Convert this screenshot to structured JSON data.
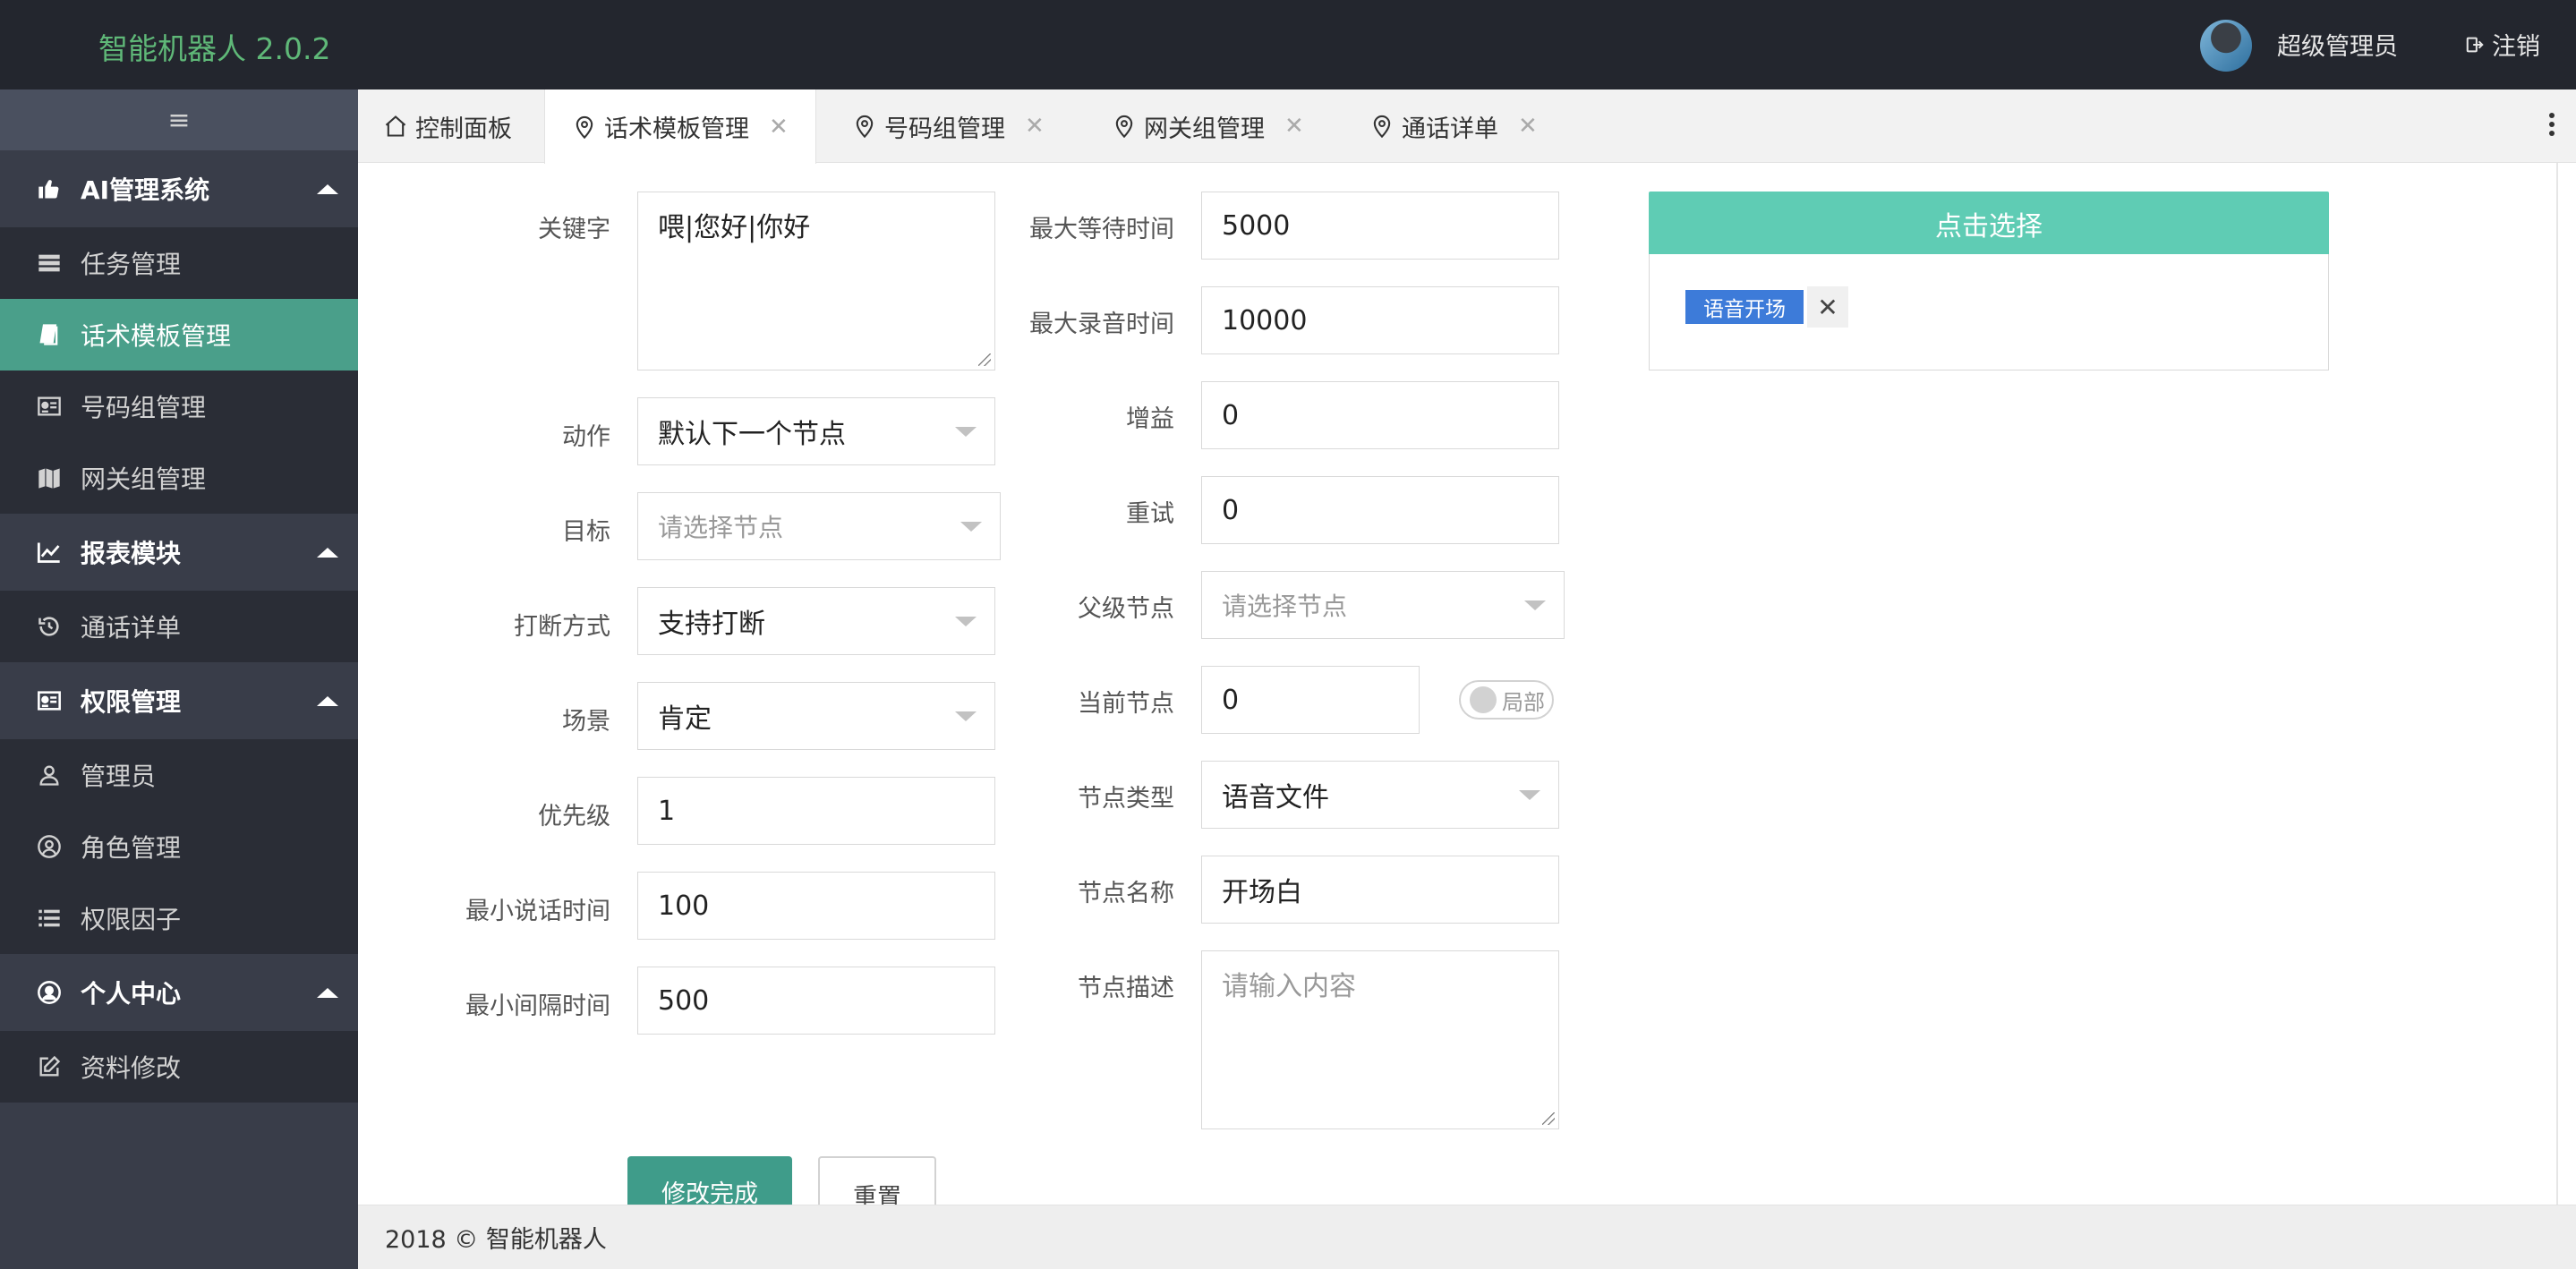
{
  "header": {
    "brand": "智能机器人 2.0.2",
    "username": "超级管理员",
    "logout": "注销"
  },
  "sidebar": {
    "toggle_icon": "menu-icon",
    "groups": [
      {
        "label": "AI管理系统",
        "icon": "thumbs-up-icon"
      },
      {
        "label": "报表模块",
        "icon": "line-chart-icon"
      },
      {
        "label": "权限管理",
        "icon": "id-card-icon"
      },
      {
        "label": "个人中心",
        "icon": "user-circle-icon"
      }
    ],
    "items": [
      {
        "label": "任务管理",
        "icon": "server-icon"
      },
      {
        "label": "话术模板管理",
        "icon": "book-icon",
        "active": true
      },
      {
        "label": "号码组管理",
        "icon": "id-card-icon"
      },
      {
        "label": "网关组管理",
        "icon": "map-icon"
      },
      {
        "label": "通话详单",
        "icon": "history-icon"
      },
      {
        "label": "管理员",
        "icon": "user-icon"
      },
      {
        "label": "角色管理",
        "icon": "user-circle-icon"
      },
      {
        "label": "权限因子",
        "icon": "list-icon"
      },
      {
        "label": "资料修改",
        "icon": "edit-icon"
      }
    ]
  },
  "tabs": [
    {
      "label": "控制面板",
      "icon": "home-icon"
    },
    {
      "label": "话术模板管理",
      "icon": "location-icon",
      "active": true
    },
    {
      "label": "号码组管理",
      "icon": "location-icon"
    },
    {
      "label": "网关组管理",
      "icon": "location-icon"
    },
    {
      "label": "通话详单",
      "icon": "location-icon"
    }
  ],
  "form": {
    "keyword": {
      "label": "关键字",
      "value": "喂|您好|你好"
    },
    "action": {
      "label": "动作",
      "value": "默认下一个节点"
    },
    "target": {
      "label": "目标",
      "placeholder": "请选择节点"
    },
    "interrupt": {
      "label": "打断方式",
      "value": "支持打断"
    },
    "scene": {
      "label": "场景",
      "value": "肯定"
    },
    "priority": {
      "label": "优先级",
      "value": "1"
    },
    "min_speak": {
      "label": "最小说话时间",
      "value": "100"
    },
    "min_interval": {
      "label": "最小间隔时间",
      "value": "500"
    },
    "max_wait": {
      "label": "最大等待时间",
      "value": "5000"
    },
    "max_record": {
      "label": "最大录音时间",
      "value": "10000"
    },
    "gain": {
      "label": "增益",
      "value": "0"
    },
    "retry": {
      "label": "重试",
      "value": "0"
    },
    "parent_node": {
      "label": "父级节点",
      "placeholder": "请选择节点"
    },
    "current_node": {
      "label": "当前节点",
      "value": "0",
      "switch_label": "局部"
    },
    "node_type": {
      "label": "节点类型",
      "value": "语音文件"
    },
    "node_name": {
      "label": "节点名称",
      "value": "开场白"
    },
    "node_desc": {
      "label": "节点描述",
      "placeholder": "请输入内容"
    }
  },
  "picker": {
    "button": "点击选择",
    "tag": "语音开场",
    "tag_close": "✕"
  },
  "buttons": {
    "submit": "修改完成",
    "reset": "重置"
  },
  "footer": "2018 © 智能机器人",
  "colors": {
    "header_bg": "#23262e",
    "brand": "#5fb878",
    "sidebar_bg": "#393d49",
    "active_item": "#4a9f8a",
    "picker_button": "#5fccb4",
    "tag": "#3d7bd9"
  }
}
